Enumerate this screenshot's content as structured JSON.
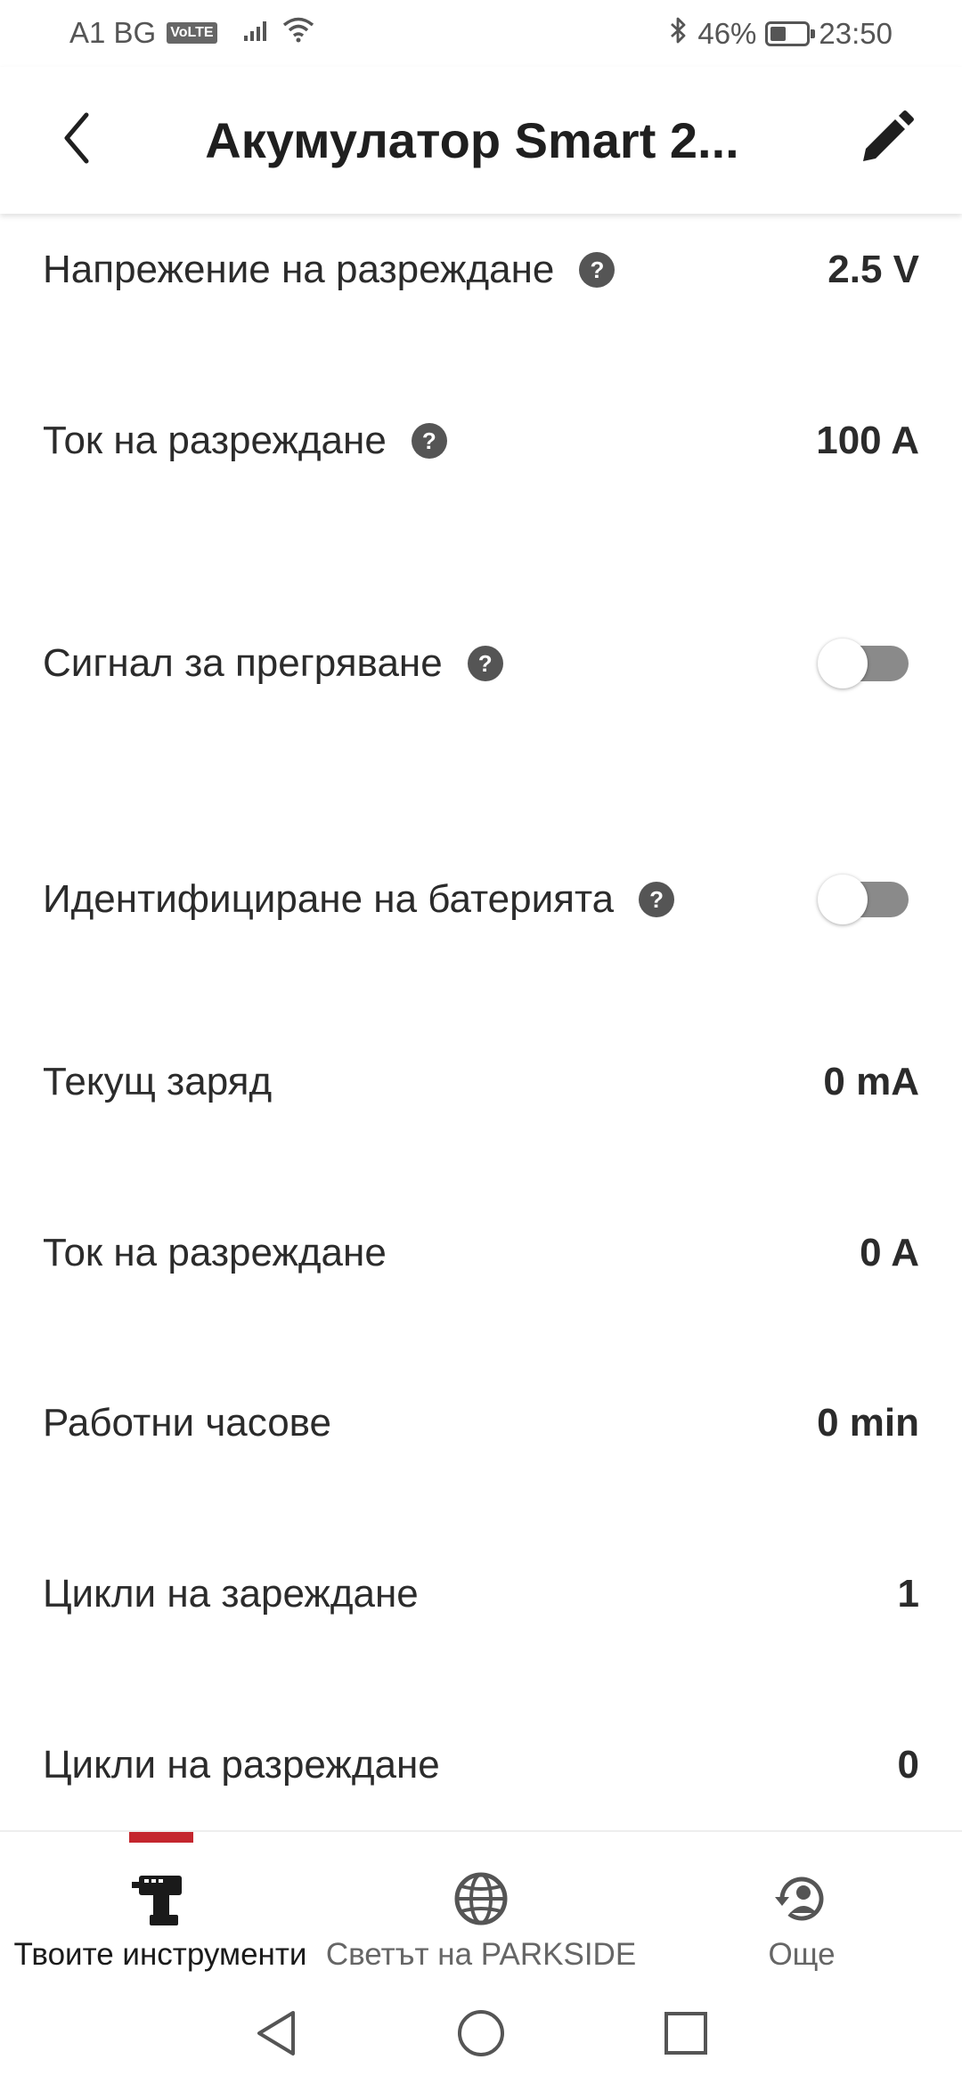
{
  "status_bar": {
    "carrier": "A1 BG",
    "volte": "VoLTE",
    "battery_percent": "46%",
    "battery_level": 0.46,
    "time": "23:50"
  },
  "header": {
    "title": "Акумулатор Smart 2..."
  },
  "rows": [
    {
      "label": "Напрежение на разреждане",
      "value": "2.5 V"
    },
    {
      "label": "Ток на разреждане",
      "value": "100 A"
    },
    {
      "label": "Сигнал за прегряване",
      "toggle_on": false
    },
    {
      "label": "Идентифициране на батерията",
      "toggle_on": false
    },
    {
      "label": "Текущ заряд",
      "value": "0 mA"
    },
    {
      "label": "Ток на разреждане",
      "value": "0 A"
    },
    {
      "label": "Работни часове",
      "value": "0 min"
    },
    {
      "label": "Цикли на зареждане",
      "value": "1"
    },
    {
      "label": "Цикли на разреждане",
      "value": "0"
    }
  ],
  "help_glyph": "?",
  "bottom_nav": {
    "items": [
      {
        "label": "Твоите инструменти",
        "icon": "drill-icon",
        "active": true
      },
      {
        "label": "Светът на PARKSIDE",
        "icon": "globe-icon",
        "active": false
      },
      {
        "label": "Още",
        "icon": "account-refresh-icon",
        "active": false
      }
    ]
  },
  "colors": {
    "accent": "#c4262e",
    "text": "#2b2b2b",
    "muted": "#666666"
  }
}
